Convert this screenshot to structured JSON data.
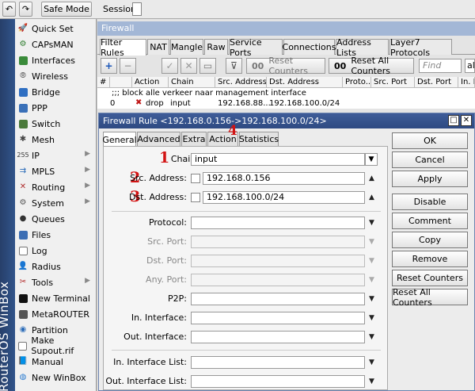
{
  "toolbar": {
    "undo_icon": "undo-icon",
    "redo_icon": "redo-icon",
    "safe_mode": "Safe Mode",
    "session_label": "Session:"
  },
  "branding": {
    "text": "RouterOS WinBox"
  },
  "sidebar": {
    "items": [
      {
        "label": "Quick Set",
        "icon": "quick-set-icon",
        "arrow": false
      },
      {
        "label": "CAPsMAN",
        "icon": "capsman-icon",
        "arrow": false
      },
      {
        "label": "Interfaces",
        "icon": "interfaces-icon",
        "arrow": false
      },
      {
        "label": "Wireless",
        "icon": "wireless-icon",
        "arrow": false
      },
      {
        "label": "Bridge",
        "icon": "bridge-icon",
        "arrow": false
      },
      {
        "label": "PPP",
        "icon": "ppp-icon",
        "arrow": false
      },
      {
        "label": "Switch",
        "icon": "switch-icon",
        "arrow": false
      },
      {
        "label": "Mesh",
        "icon": "mesh-icon",
        "arrow": false
      },
      {
        "label": "IP",
        "icon": "ip-icon",
        "arrow": true
      },
      {
        "label": "MPLS",
        "icon": "mpls-icon",
        "arrow": true
      },
      {
        "label": "Routing",
        "icon": "routing-icon",
        "arrow": true
      },
      {
        "label": "System",
        "icon": "system-icon",
        "arrow": true
      },
      {
        "label": "Queues",
        "icon": "queues-icon",
        "arrow": false
      },
      {
        "label": "Files",
        "icon": "files-icon",
        "arrow": false
      },
      {
        "label": "Log",
        "icon": "log-icon",
        "arrow": false
      },
      {
        "label": "Radius",
        "icon": "radius-icon",
        "arrow": false
      },
      {
        "label": "Tools",
        "icon": "tools-icon",
        "arrow": true
      },
      {
        "label": "New Terminal",
        "icon": "terminal-icon",
        "arrow": false
      },
      {
        "label": "MetaROUTER",
        "icon": "metarouter-icon",
        "arrow": false
      },
      {
        "label": "Partition",
        "icon": "partition-icon",
        "arrow": false
      },
      {
        "label": "Make Supout.rif",
        "icon": "supout-icon",
        "arrow": false
      },
      {
        "label": "Manual",
        "icon": "manual-icon",
        "arrow": false
      },
      {
        "label": "New WinBox",
        "icon": "new-winbox-icon",
        "arrow": false
      }
    ]
  },
  "firewall": {
    "title": "Firewall",
    "tabs": [
      "Filter Rules",
      "NAT",
      "Mangle",
      "Raw",
      "Service Ports",
      "Connections",
      "Address Lists",
      "Layer7 Protocols"
    ],
    "reset_counters": "Reset Counters",
    "reset_all_counters": "Reset All Counters",
    "reset_all_prefix": "00",
    "reset_prefix": "00",
    "find_placeholder": "Find",
    "find_extra": "al",
    "table": {
      "columns": [
        "#",
        "Action",
        "Chain",
        "Src. Address",
        "Dst. Address",
        "Proto...",
        "Src. Port",
        "Dst. Port",
        "In. In"
      ],
      "comment": ";;; block alle verkeer naar management interface",
      "row": {
        "num": "0",
        "action": "drop",
        "chain": "input",
        "src": "192.168.88...",
        "dst": "192.168.100.0/24"
      }
    }
  },
  "dialog": {
    "title": "Firewall Rule <192.168.0.156->192.168.100.0/24>",
    "tabs": [
      "General",
      "Advanced",
      "Extra",
      "Action",
      "Statistics"
    ],
    "fields": {
      "chain": {
        "label": "Chain:",
        "value": "input"
      },
      "src_address": {
        "label": "Src. Address:",
        "value": "192.168.0.156"
      },
      "dst_address": {
        "label": "Dst. Address:",
        "value": "192.168.100.0/24"
      },
      "protocol": {
        "label": "Protocol:"
      },
      "src_port": {
        "label": "Src. Port:"
      },
      "dst_port": {
        "label": "Dst. Port:"
      },
      "any_port": {
        "label": "Any. Port:"
      },
      "p2p": {
        "label": "P2P:"
      },
      "in_interface": {
        "label": "In. Interface:"
      },
      "out_interface": {
        "label": "Out. Interface:"
      },
      "in_interface_list": {
        "label": "In. Interface List:"
      },
      "out_interface_list": {
        "label": "Out. Interface List:"
      }
    },
    "buttons": [
      "OK",
      "Cancel",
      "Apply",
      "Disable",
      "Comment",
      "Copy",
      "Remove",
      "Reset Counters",
      "Reset All Counters"
    ],
    "annotations": {
      "n1": "1",
      "n2": "2",
      "n3": "3",
      "n4": "4"
    }
  }
}
